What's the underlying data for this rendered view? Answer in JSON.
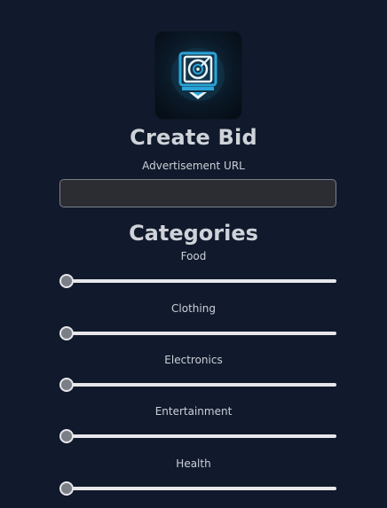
{
  "header": {
    "title": "Create Bid"
  },
  "form": {
    "url_label": "Advertisement URL",
    "url_value": "",
    "url_placeholder": ""
  },
  "categories": {
    "title": "Categories",
    "sliders": [
      {
        "label": "Food",
        "value_fraction": 0
      },
      {
        "label": "Clothing",
        "value_fraction": 0
      },
      {
        "label": "Electronics",
        "value_fraction": 0
      },
      {
        "label": "Entertainment",
        "value_fraction": 0
      },
      {
        "label": "Health",
        "value_fraction": 0
      }
    ]
  },
  "icons": {
    "logo": "bid-target-logo-icon"
  },
  "colors": {
    "background": "#111a2c",
    "accent": "#2aa4d8",
    "text": "#cfd3d9",
    "input_bg": "#2c2c33",
    "track": "#e7e7ea",
    "thumb": "#7a7e86"
  }
}
